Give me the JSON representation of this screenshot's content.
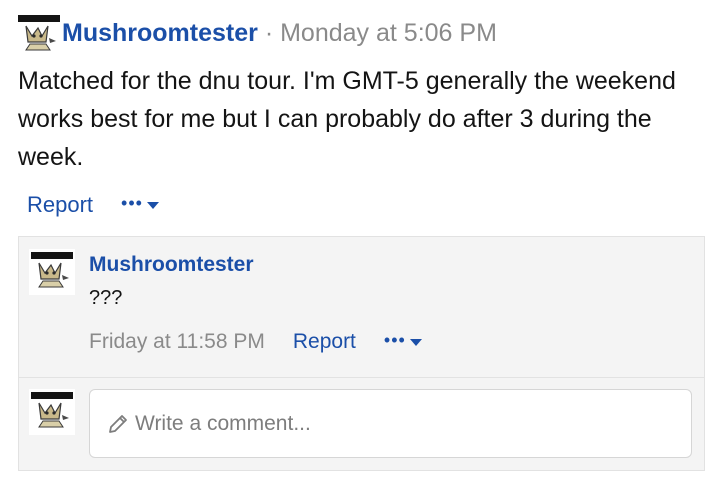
{
  "post": {
    "author": "Mushroomtester",
    "separator": "·",
    "timestamp": "Monday at 5:06 PM",
    "body": "Matched for the dnu tour. I'm GMT-5 generally the weekend works best for me but I can probably do after 3 during the week.",
    "report_label": "Report",
    "more_label": "•••"
  },
  "comment": {
    "author": "Mushroomtester",
    "text": "???",
    "timestamp": "Friday at 11:58 PM",
    "report_label": "Report",
    "more_label": "•••"
  },
  "composer": {
    "placeholder": "Write a comment..."
  },
  "colors": {
    "link": "#1b4fa8",
    "muted": "#8a8a8a",
    "panel": "#f4f4f4"
  },
  "icons": {
    "avatar": "eevee-pokemon-avatar-icon",
    "more": "chevron-down-icon",
    "composer": "pencil-icon"
  }
}
